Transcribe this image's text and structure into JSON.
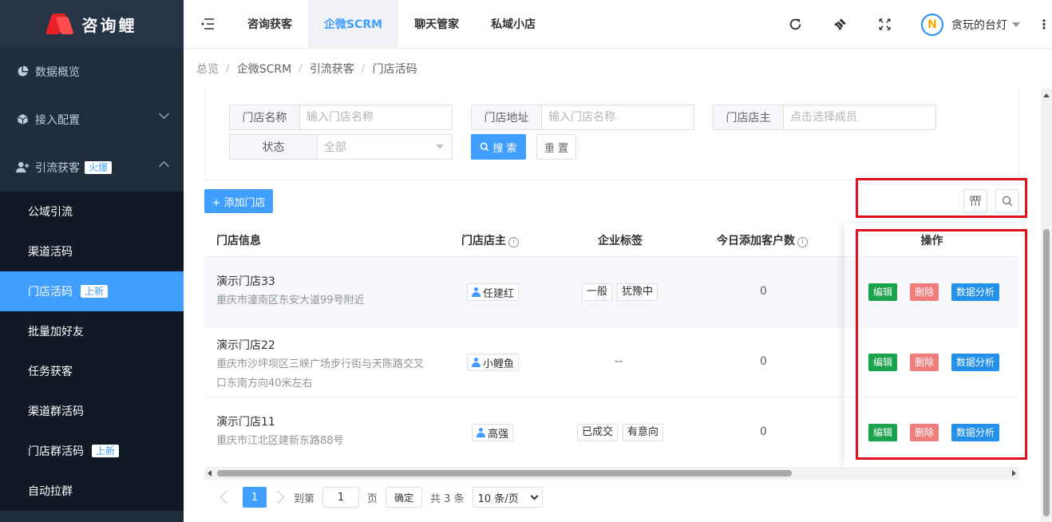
{
  "brand": {
    "name": "咨询鲤"
  },
  "sidebar": {
    "items": [
      {
        "label": "数据概览",
        "icon": "pie-chart-icon"
      },
      {
        "label": "接入配置",
        "icon": "cube-icon"
      },
      {
        "label": "引流获客",
        "icon": "add-user-icon",
        "badge": "火爆"
      }
    ],
    "submenu": [
      {
        "label": "公域引流"
      },
      {
        "label": "渠道活码"
      },
      {
        "label": "门店活码",
        "badge": "上新",
        "active": true
      },
      {
        "label": "批量加好友"
      },
      {
        "label": "任务获客"
      },
      {
        "label": "渠道群活码"
      },
      {
        "label": "门店群活码",
        "badge": "上新"
      },
      {
        "label": "自动拉群"
      }
    ]
  },
  "topbar": {
    "tabs": [
      "咨询获客",
      "企微SCRM",
      "聊天管家",
      "私域小店"
    ],
    "active_tab": "企微SCRM",
    "user": {
      "name": "贪玩的台灯",
      "avatar_letter": "N"
    }
  },
  "breadcrumb": [
    "总览",
    "企微SCRM",
    "引流获客",
    "门店活码"
  ],
  "filters": {
    "store_name": {
      "label": "门店名称",
      "placeholder": "输入门店名称"
    },
    "store_address": {
      "label": "门店地址",
      "placeholder": "输入门店名称"
    },
    "store_owner": {
      "label": "门店店主",
      "placeholder": "点击选择成员"
    },
    "status": {
      "label": "状态",
      "value": "全部"
    },
    "search_label": "搜 索",
    "reset_label": "重 置"
  },
  "add_button": "+ 添加门店",
  "table": {
    "headers": {
      "info": "门店信息",
      "owner": "门店店主",
      "tags": "企业标签",
      "today_added": "今日添加客户数",
      "actions": "操作"
    },
    "rows": [
      {
        "name": "演示门店33",
        "address": "重庆市潼南区东安大道99号附近",
        "address2": "",
        "owner": "任建红",
        "tags": [
          "一般",
          "犹豫中"
        ],
        "today_added": "0"
      },
      {
        "name": "演示门店22",
        "address": "重庆市沙坪坝区三峡广场步行街与天陈路交叉",
        "address2": "口东南方向40米左右",
        "owner": "小鲤鱼",
        "tags": [],
        "empty_tags": "--",
        "today_added": "0"
      },
      {
        "name": "演示门店11",
        "address": "重庆市江北区建新东路88号",
        "address2": "",
        "owner": "高强",
        "tags": [
          "已成交",
          "有意向"
        ],
        "today_added": "0"
      }
    ],
    "actions": {
      "edit": "编辑",
      "delete": "删除",
      "analytics": "数据分析"
    }
  },
  "pagination": {
    "current_page": "1",
    "goto_label": "到第",
    "goto_value": "1",
    "page_label": "页",
    "confirm_label": "确定",
    "total_label": "共 3 条",
    "page_size": "10 条/页"
  },
  "colors": {
    "primary": "#409eff",
    "edit": "#1aa34a",
    "delete": "#f07c7c",
    "analytics": "#2490e8",
    "highlight": "#e0101e"
  }
}
